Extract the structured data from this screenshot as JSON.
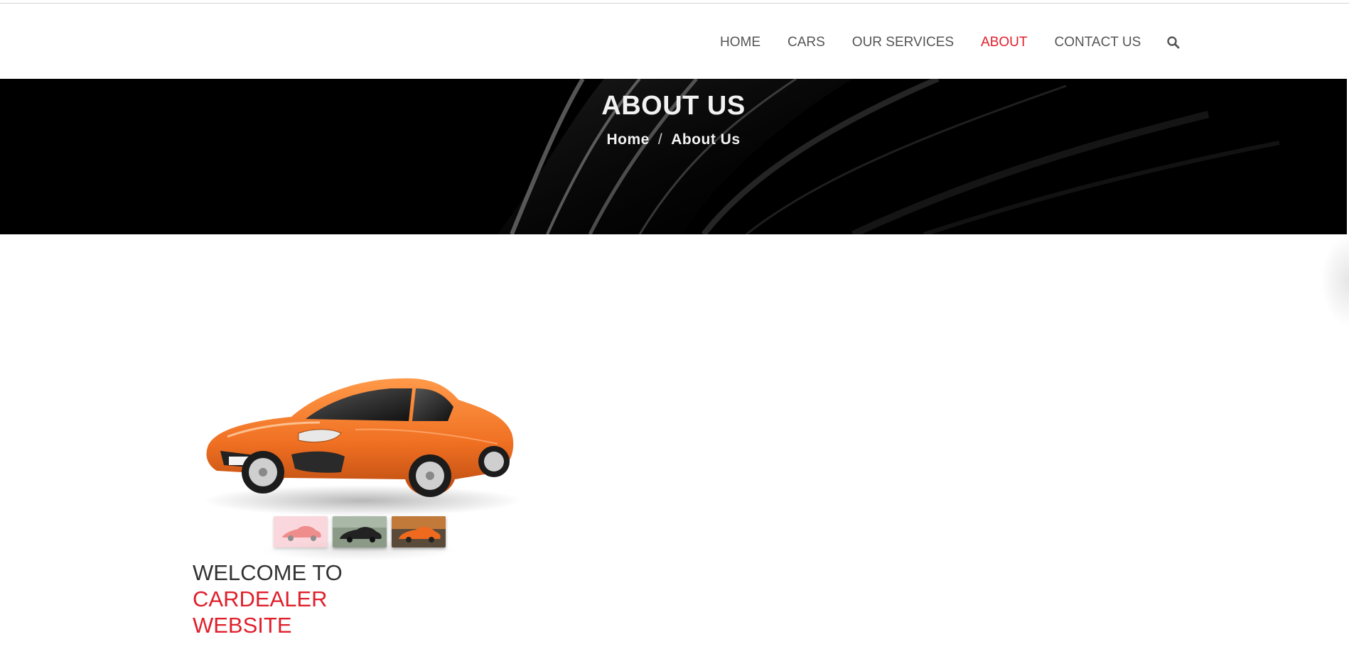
{
  "nav": {
    "items": [
      {
        "label": "HOME"
      },
      {
        "label": "CARS"
      },
      {
        "label": "OUR SERVICES"
      },
      {
        "label": "ABOUT"
      },
      {
        "label": "CONTACT US"
      }
    ],
    "active": "ABOUT",
    "search_icon": "search-icon"
  },
  "banner": {
    "title": "ABOUT US",
    "breadcrumb": {
      "home": "Home",
      "separator": "/",
      "current": "About Us"
    }
  },
  "hero": {
    "thumbnails": [
      "red sports car",
      "black sports car",
      "orange sports car"
    ],
    "active_thumbnail": 0
  },
  "welcome": {
    "line1": "WELCOME TO",
    "line2": "CARDEALER",
    "line3": "WEBSITE"
  },
  "colors": {
    "accent": "#e01f2b",
    "nav_text": "#555555",
    "banner_bg": "#000000",
    "car": "#f07022"
  }
}
